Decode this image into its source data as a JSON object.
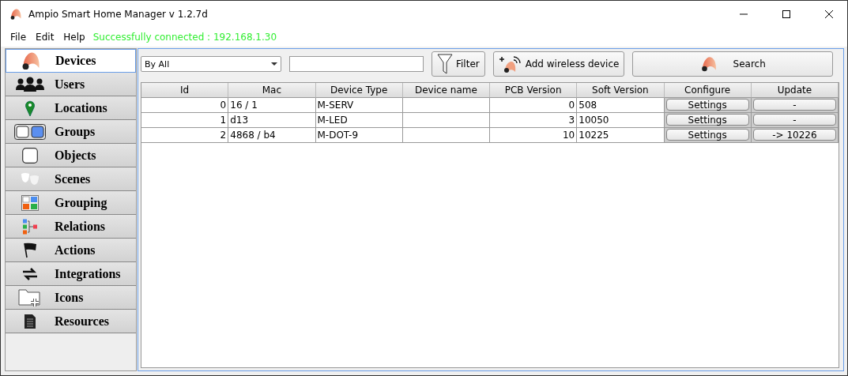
{
  "window": {
    "title": "Ampio Smart Home Manager v 1.2.7d"
  },
  "menu": [
    "File",
    "Edit",
    "Help"
  ],
  "status": "Successfully connected : 192.168.1.30",
  "sidebar": {
    "items": [
      {
        "label": "Devices",
        "selected": true
      },
      {
        "label": "Users",
        "selected": false
      },
      {
        "label": "Locations",
        "selected": false
      },
      {
        "label": "Groups",
        "selected": false
      },
      {
        "label": "Objects",
        "selected": false
      },
      {
        "label": "Scenes",
        "selected": false
      },
      {
        "label": "Grouping",
        "selected": false
      },
      {
        "label": "Relations",
        "selected": false
      },
      {
        "label": "Actions",
        "selected": false
      },
      {
        "label": "Integrations",
        "selected": false
      },
      {
        "label": "Icons",
        "selected": false
      },
      {
        "label": "Resources",
        "selected": false
      }
    ]
  },
  "toolbar": {
    "filter_select": "By All",
    "filter_button": "Filter",
    "add_button": "Add wireless device",
    "search_button": "Search"
  },
  "table": {
    "columns": [
      "Id",
      "Mac",
      "Device Type",
      "Device name",
      "PCB Version",
      "Soft Version",
      "Configure",
      "Update"
    ],
    "rows": [
      [
        "0",
        "16 / 1",
        "M-SERV",
        "",
        "0",
        "508",
        "Settings",
        "-"
      ],
      [
        "1",
        "d13",
        "M-LED",
        "",
        "3",
        "10050",
        "Settings",
        "-"
      ],
      [
        "2",
        "4868 / b4",
        "M-DOT-9",
        "",
        "10",
        "10225",
        "Settings",
        "-> 10226"
      ]
    ]
  }
}
